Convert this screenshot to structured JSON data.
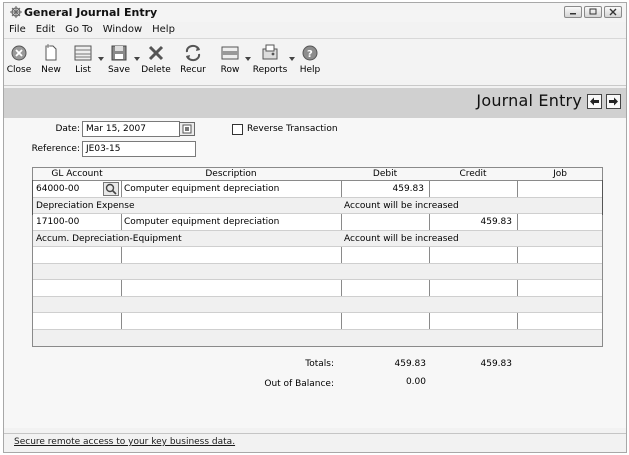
{
  "window": {
    "title": "General Journal Entry"
  },
  "menu": [
    "File",
    "Edit",
    "Go To",
    "Window",
    "Help"
  ],
  "toolbar": {
    "close": "Close",
    "new": "New",
    "list": "List",
    "save": "Save",
    "delete": "Delete",
    "recur": "Recur",
    "row": "Row",
    "reports": "Reports",
    "help": "Help"
  },
  "header": {
    "title": "Journal Entry"
  },
  "form": {
    "date_label": "Date:",
    "date_value": "Mar 15, 2007",
    "reference_label": "Reference:",
    "reference_value": "JE03-15",
    "reverse_label": "Reverse Transaction",
    "reverse_checked": false
  },
  "grid": {
    "columns": [
      "GL Account",
      "Description",
      "Debit",
      "Credit",
      "Job"
    ],
    "entries": [
      {
        "account": "64000-00",
        "description": "Computer equipment depreciation",
        "debit": "459.83",
        "credit": "",
        "job": "",
        "account_name": "Depreciation Expense",
        "note": "Account will be increased"
      },
      {
        "account": "17100-00",
        "description": "Computer equipment depreciation",
        "debit": "",
        "credit": "459.83",
        "job": "",
        "account_name": "Accum. Depreciation-Equipment",
        "note": "Account will be increased"
      }
    ]
  },
  "totals": {
    "totals_label": "Totals:",
    "debit_total": "459.83",
    "credit_total": "459.83",
    "out_of_balance_label": "Out of Balance:",
    "out_of_balance_value": "0.00"
  },
  "status": {
    "link": "Secure remote access to your key business data."
  }
}
